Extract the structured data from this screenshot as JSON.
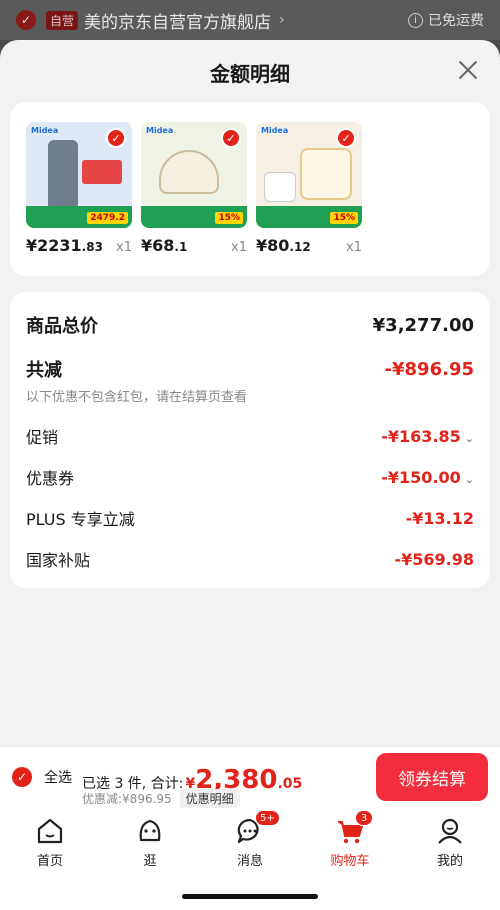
{
  "store": {
    "check_icon": "check-circle-icon",
    "badge": "自营",
    "name": "美的京东自营官方旗舰店",
    "chevron": "›",
    "free_shipping": "已免运费"
  },
  "sheet": {
    "title": "金额明细",
    "close_icon": "close-icon"
  },
  "products": [
    {
      "brand": "Midea",
      "price_int": "¥2231",
      "price_dec": ".83",
      "qty": "x1",
      "promo": "2479.2"
    },
    {
      "brand": "Midea",
      "price_int": "¥68",
      "price_dec": ".1",
      "qty": "x1",
      "promo": "15%"
    },
    {
      "brand": "Midea",
      "price_int": "¥80",
      "price_dec": ".12",
      "qty": "x1",
      "promo": "15%"
    }
  ],
  "summary": {
    "total_label": "商品总价",
    "total_value": "¥3,277.00",
    "reduce_label": "共减",
    "reduce_value": "-¥896.95",
    "note": "以下优惠不包含红包，请在结算页查看",
    "promo_label": "促销",
    "promo_value": "-¥163.85",
    "coupon_label": "优惠券",
    "coupon_value": "-¥150.00",
    "plus_label": "PLUS 专享立减",
    "plus_value": "-¥13.12",
    "subsidy_label": "国家补贴",
    "subsidy_value": "-¥569.98"
  },
  "checkout": {
    "select_all": "全选",
    "selected_text": "已选 3 件, 合计:",
    "currency": "¥",
    "amount_int": "2,380",
    "amount_dec": ".05",
    "discount_text": "优惠减:¥896.95",
    "detail_label": "优惠明细",
    "button_label": "领券结算"
  },
  "tabs": [
    {
      "label": "首页",
      "icon": "home-icon",
      "badge": ""
    },
    {
      "label": "逛",
      "icon": "browse-icon",
      "badge": ""
    },
    {
      "label": "消息",
      "icon": "message-icon",
      "badge": "5+"
    },
    {
      "label": "购物车",
      "icon": "cart-icon",
      "badge": "3"
    },
    {
      "label": "我的",
      "icon": "profile-icon",
      "badge": ""
    }
  ],
  "colors": {
    "accent": "#e2231a",
    "button": "#f22e3e"
  }
}
